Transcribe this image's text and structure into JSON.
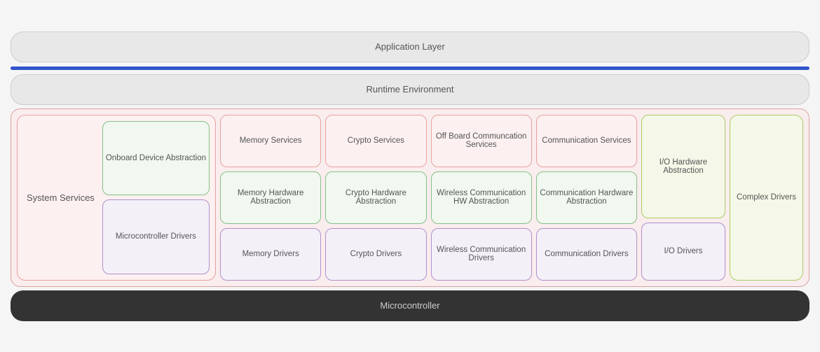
{
  "layers": {
    "app": "Application Layer",
    "runtime": "Runtime Environment",
    "micro": "Microcontroller"
  },
  "system_services": {
    "label": "System Services",
    "onboard": "Onboard Device Abstraction",
    "mcu_drivers": "Microcontroller Drivers"
  },
  "columns": [
    {
      "top": "Memory Services",
      "mid": "Memory Hardware Abstraction",
      "bot": "Memory Drivers",
      "top_color": "pink",
      "mid_color": "green",
      "bot_color": "purple"
    },
    {
      "top": "Crypto Services",
      "mid": "Crypto Hardware Abstraction",
      "bot": "Crypto Drivers",
      "top_color": "pink",
      "mid_color": "green",
      "bot_color": "purple"
    },
    {
      "top": "Off Board Communcation Services",
      "mid": "Wireless Communication HW Abstraction",
      "bot": "Wireless Communication Drivers",
      "top_color": "pink",
      "mid_color": "green",
      "bot_color": "purple"
    },
    {
      "top": "Communication Services",
      "mid": "Communication Hardware Abstraction",
      "bot": "Communication Drivers",
      "top_color": "pink",
      "mid_color": "green",
      "bot_color": "purple"
    }
  ],
  "io": {
    "top": "I/O Hardware Abstraction",
    "bot": "I/O Drivers"
  },
  "complex": {
    "label": "Complex Drivers"
  },
  "colors": {
    "pink_bg": "#fdf0f0",
    "pink_border": "#e8a0a0",
    "green_bg": "#f0f8f0",
    "green_border": "#88c088",
    "purple_bg": "#f4f0f8",
    "purple_border": "#b090cc",
    "lime_bg": "#f5f8e8",
    "lime_border": "#aacc66",
    "blue": "#3355cc",
    "dark": "#333",
    "runtime_bg": "#e8e8e8",
    "main_bg": "#f9eded",
    "main_border": "#daa0a0"
  }
}
